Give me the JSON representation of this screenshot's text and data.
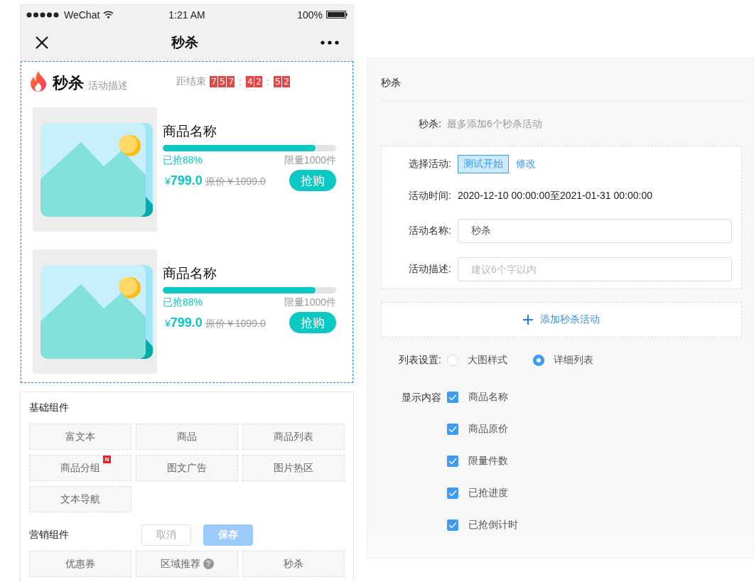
{
  "status_bar": {
    "carrier": "WeChat",
    "time": "1:21 AM",
    "battery": "100%"
  },
  "nav": {
    "title": "秒杀"
  },
  "preview": {
    "title": "秒杀",
    "description": "活动描述",
    "countdown": {
      "label": "距结束",
      "segments": [
        {
          "kind": "digits",
          "text": "757"
        },
        {
          "kind": "separator",
          "text": ":"
        },
        {
          "kind": "digits",
          "text": "42"
        },
        {
          "kind": "separator",
          "text": ":"
        },
        {
          "kind": "digits",
          "text": "52"
        }
      ]
    },
    "products": [
      {
        "name": "商品名称",
        "level": 0.88,
        "sold": "已抢88%",
        "limit": "限量1000件",
        "currency": "¥",
        "price": "799.0",
        "original_price": "原价￥1099.0",
        "buy": "抢购"
      },
      {
        "name": "商品名称",
        "level": 0.88,
        "sold": "已抢88%",
        "limit": "限量1000件",
        "currency": "¥",
        "price": "799.0",
        "original_price": "原价￥1099.0",
        "buy": "抢购"
      }
    ]
  },
  "palette": {
    "sections": [
      {
        "title": "基础组件",
        "items": [
          {
            "label": "富文本"
          },
          {
            "label": "商品"
          },
          {
            "label": "商品列表"
          },
          {
            "label": "商品分组",
            "badge": "N"
          },
          {
            "label": "图文广告"
          },
          {
            "label": "图片热区"
          },
          {
            "label": "文本导航"
          }
        ]
      },
      {
        "title": "营销组件",
        "items": [
          {
            "label": "优惠券"
          },
          {
            "label": "区域推荐",
            "help": "?"
          },
          {
            "label": "秒杀"
          }
        ]
      }
    ]
  },
  "footer": {
    "buttons": [
      {
        "label": "取消",
        "kind": "secondary"
      },
      {
        "label": "保存",
        "kind": "primary"
      }
    ]
  },
  "settings": {
    "title": "秒杀",
    "limit": {
      "label": "秒杀:",
      "hint": "最多添加6个秒杀活动"
    },
    "activity": {
      "select_label": "选择活动:",
      "tag": "测试开始",
      "edit_link": "修改",
      "time_label": "活动时间:",
      "time": "2020-12-10 00:00:00至2021-01-31 00:00:00",
      "name_label": "活动名称:",
      "name_value": "秒杀",
      "desc_label": "活动描述:",
      "desc_placeholder": "建议6个字以内"
    },
    "add_button": {
      "label": "添加秒杀活动"
    },
    "list_style": {
      "label": "列表设置:",
      "options": [
        {
          "label": "大图样式",
          "selected": false
        },
        {
          "label": "详细列表",
          "selected": true
        }
      ]
    },
    "display": {
      "label": "显示内容",
      "options": [
        {
          "label": "商品名称",
          "checked": true
        },
        {
          "label": "商品原价",
          "checked": true
        },
        {
          "label": "限量件数",
          "checked": true
        },
        {
          "label": "已抢进度",
          "checked": true
        },
        {
          "label": "已抢倒计时",
          "checked": true
        }
      ]
    }
  }
}
